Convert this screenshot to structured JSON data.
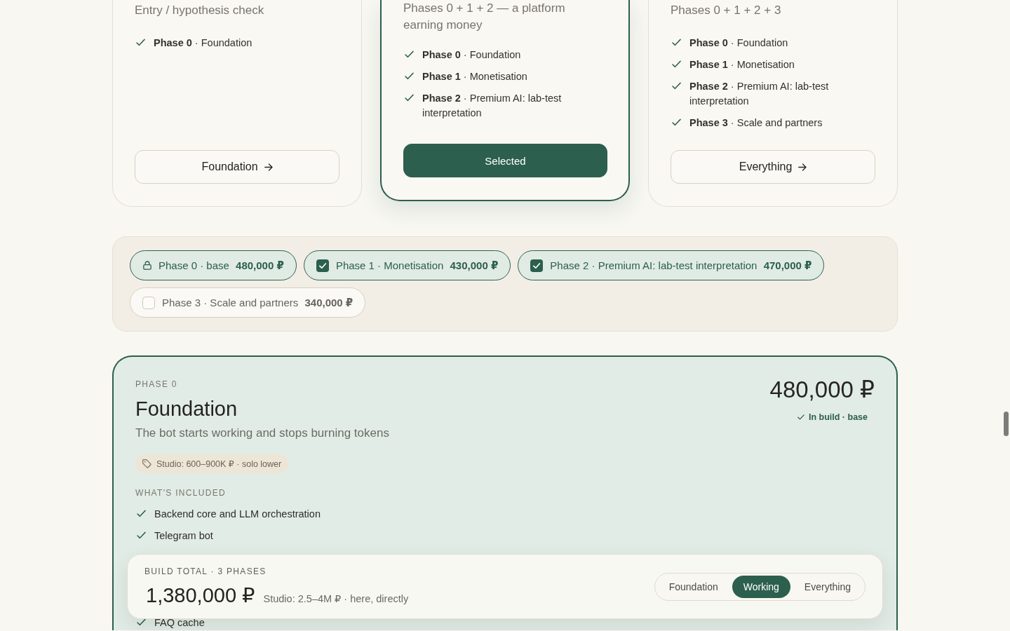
{
  "plan_cards": [
    {
      "subtitle": "Entry / hypothesis check",
      "phases": [
        "**Phase 0** · Foundation"
      ],
      "button": "Foundation",
      "selected": false
    },
    {
      "subtitle": "Phases 0 + 1 + 2 — a platform earning money",
      "phases": [
        "**Phase 0** · Foundation",
        "**Phase 1** · Monetisation",
        "**Phase 2** · Premium AI: lab-test interpretation"
      ],
      "button": "Selected",
      "selected": true
    },
    {
      "subtitle": "Phases 0 + 1 + 2 + 3",
      "phases": [
        "**Phase 0** · Foundation",
        "**Phase 1** · Monetisation",
        "**Phase 2** · Premium AI: lab-test interpretation",
        "**Phase 3** · Scale and partners"
      ],
      "button": "Everything",
      "selected": false
    }
  ],
  "phase_options": [
    {
      "kind": "locked",
      "label": "Phase 0 · base",
      "price": "480,000 ₽",
      "selected": true
    },
    {
      "kind": "checkbox",
      "label": "Phase 1 · Monetisation",
      "price": "430,000 ₽",
      "selected": true
    },
    {
      "kind": "checkbox",
      "label": "Phase 2 · Premium AI: lab-test interpretation",
      "price": "470,000 ₽",
      "selected": true
    },
    {
      "kind": "checkbox",
      "label": "Phase 3 · Scale and partners",
      "price": "340,000 ₽",
      "selected": false
    }
  ],
  "phase_detail": {
    "eyebrow": "PHASE 0",
    "title": "Foundation",
    "description": "The bot starts working and stops burning tokens",
    "studio_tag": "Studio: 600–900K ₽ · solo lower",
    "price": "480,000 ₽",
    "status": "In build · base",
    "included_heading": "WHAT'S INCLUDED",
    "included": [
      "Backend core and LLM orchestration",
      "Telegram bot",
      "FAQ cache"
    ]
  },
  "total_bar": {
    "label": "BUILD TOTAL · 3 PHASES",
    "amount": "1,380,000 ₽",
    "note": "Studio: 2.5–4M ₽ · here, directly",
    "options": [
      {
        "label": "Foundation",
        "selected": false
      },
      {
        "label": "Working",
        "selected": true
      },
      {
        "label": "Everything",
        "selected": false
      }
    ]
  }
}
